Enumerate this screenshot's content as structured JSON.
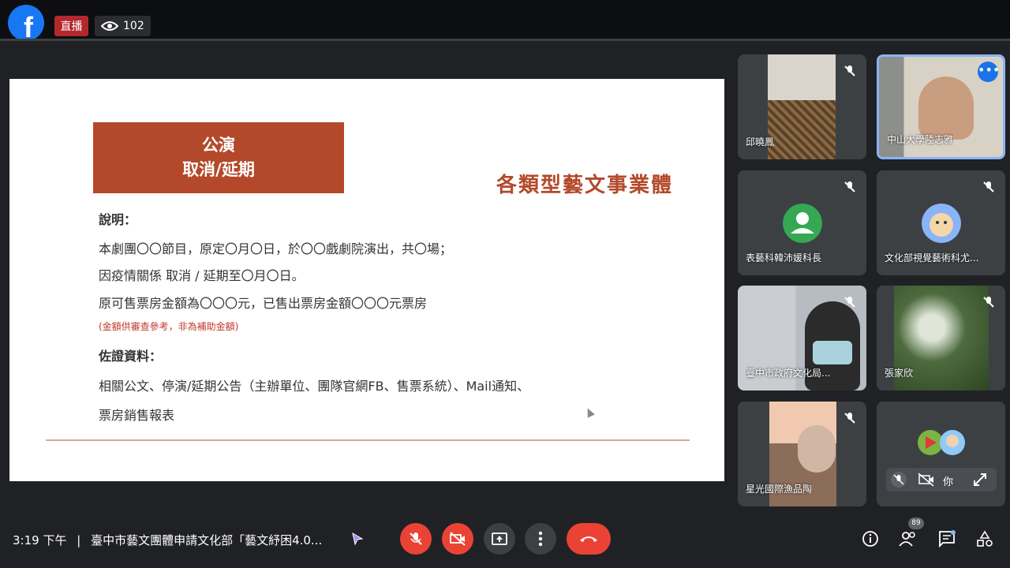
{
  "fb": {
    "logo": "f",
    "live_label": "直播",
    "viewer_count": "102"
  },
  "slide": {
    "title_line1": "公演",
    "title_line2": "取消/延期",
    "heading": "各類型藝文事業體",
    "desc_label": "說明：",
    "desc_line1": "本劇團〇〇節目，原定〇月〇日，於〇〇戲劇院演出，共〇場；",
    "desc_line2": "因疫情關係 取消 / 延期至〇月〇日。",
    "desc_line3": "原可售票房金額為〇〇〇元，已售出票房金額〇〇〇元票房",
    "desc_note": "(金額供審查參考，非為補助金額)",
    "evidence_label": "佐證資料：",
    "evidence_line1": "相關公文、停演/延期公告（主辦單位、團隊官網FB、售票系統）、Mail通知、",
    "evidence_line2": "票房銷售報表"
  },
  "participants": [
    {
      "name": "邱曉鳳"
    },
    {
      "name": "中山大學陸志雅"
    },
    {
      "name": "表藝科韓沛媛科長"
    },
    {
      "name": "文化部視覺藝術科尤..."
    },
    {
      "name": "臺中市政府文化局..."
    },
    {
      "name": "張家欣"
    },
    {
      "name": "星光國際漁品陶"
    },
    {
      "name": "你"
    }
  ],
  "bottom": {
    "time": "3:19 下午",
    "separator": "|",
    "meeting_title": "臺中市藝文團體申請文化部「藝文紓困4.0...",
    "people_count": "89"
  },
  "colors": {
    "accent": "#b3492a",
    "danger": "#ea4335",
    "tile": "#3c4043",
    "active_border": "#8ab4f8"
  }
}
